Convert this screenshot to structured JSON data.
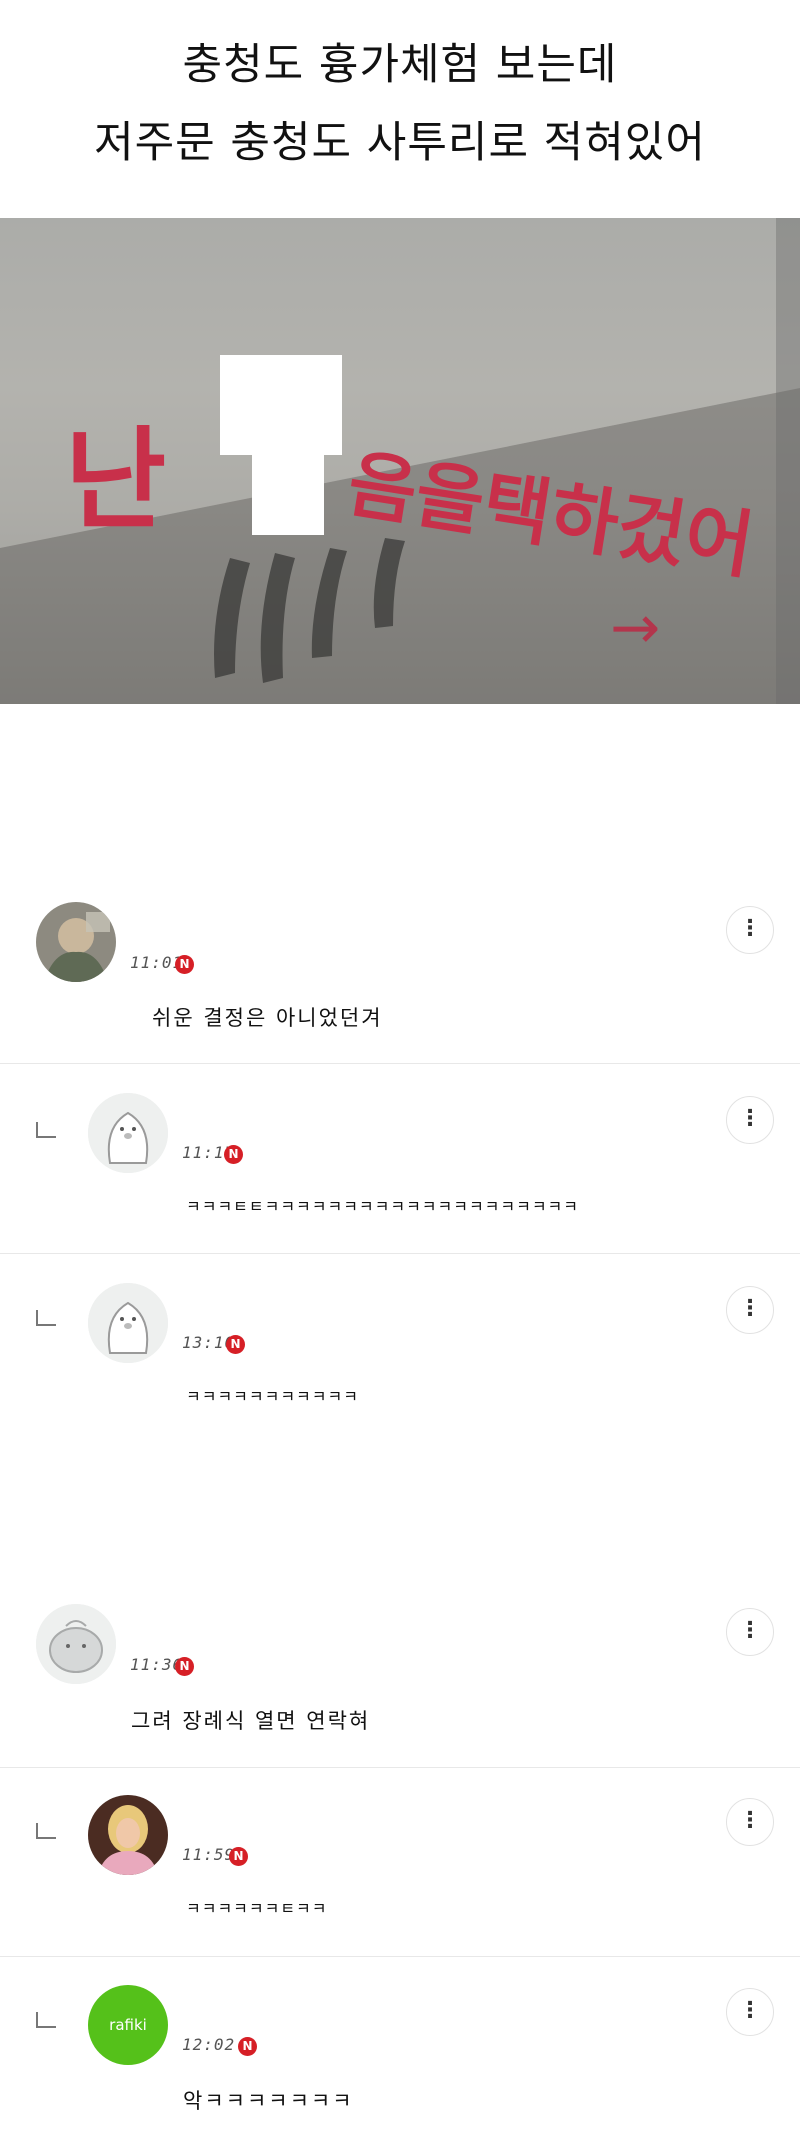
{
  "post": {
    "title_line1": "충청도 흉가체험 보는데",
    "title_line2": "저주문 충청도 사투리로 적혀있어"
  },
  "photo": {
    "graffiti_visible_left": "난",
    "graffiti_visible_right": "음을택하겄어",
    "graffiti_arrow_glyph": "→",
    "censor_color": "#ffffff",
    "graffiti_color": "#c8304a"
  },
  "comments": [
    {
      "reply": false,
      "avatar": "photo-avatar",
      "time": "11:01",
      "badge": "N",
      "text": "쉬운 결정은 아니었던겨"
    },
    {
      "reply": true,
      "avatar": "penguin-avatar",
      "time": "11:17",
      "badge": "N",
      "text": "ㅋㅋㅋㅌㅌㅋㅋㅋㅋㅋㅋㅋㅋㅋㅋㅋㅋㅋㅋㅋㅋㅋㅋㅋㅋ"
    },
    {
      "reply": true,
      "avatar": "penguin-avatar",
      "time": "13:10",
      "badge": "N",
      "text": "ㅋㅋㅋㅋㅋㅋㅋㅋㅋㅋㅋ"
    },
    {
      "reply": false,
      "avatar": "ghost-avatar",
      "time": "11:36",
      "badge": "N",
      "text": "그려 장례식 열면 연락혀"
    },
    {
      "reply": true,
      "avatar": "person-avatar",
      "time": "11:59",
      "badge": "N",
      "text": "ㅋㅋㅋㅋㅋㅋㅌㅋㅋ"
    },
    {
      "reply": true,
      "avatar": "rafiki-avatar",
      "avatar_text": "rafiki",
      "time": "12:02",
      "badge": "N",
      "text": "악ㅋㅋㅋㅋㅋㅋㅋ"
    }
  ],
  "ui": {
    "more_glyph": "⋮",
    "accent_badge": "#d61f26",
    "rafiki_color": "#55c11a"
  }
}
